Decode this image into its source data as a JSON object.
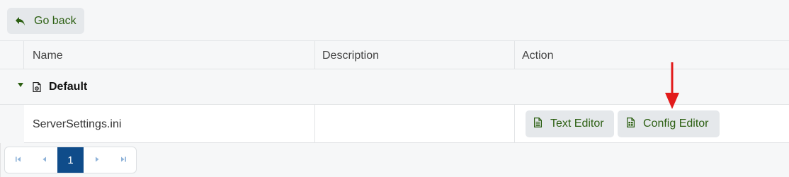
{
  "toolbar": {
    "back_label": "Go back"
  },
  "table": {
    "columns": [
      "Name",
      "Description",
      "Action"
    ],
    "group": {
      "label": "Default"
    },
    "rows": [
      {
        "name": "ServerSettings.ini",
        "description": "",
        "actions": [
          "Text Editor",
          "Config Editor"
        ]
      }
    ]
  },
  "pagination": {
    "current_page": "1"
  },
  "colors": {
    "accent_green": "#2c5f12",
    "button_bg": "#e5e8eb",
    "pager_active": "#0f4c8a",
    "annotation_red": "#e21b1b"
  }
}
